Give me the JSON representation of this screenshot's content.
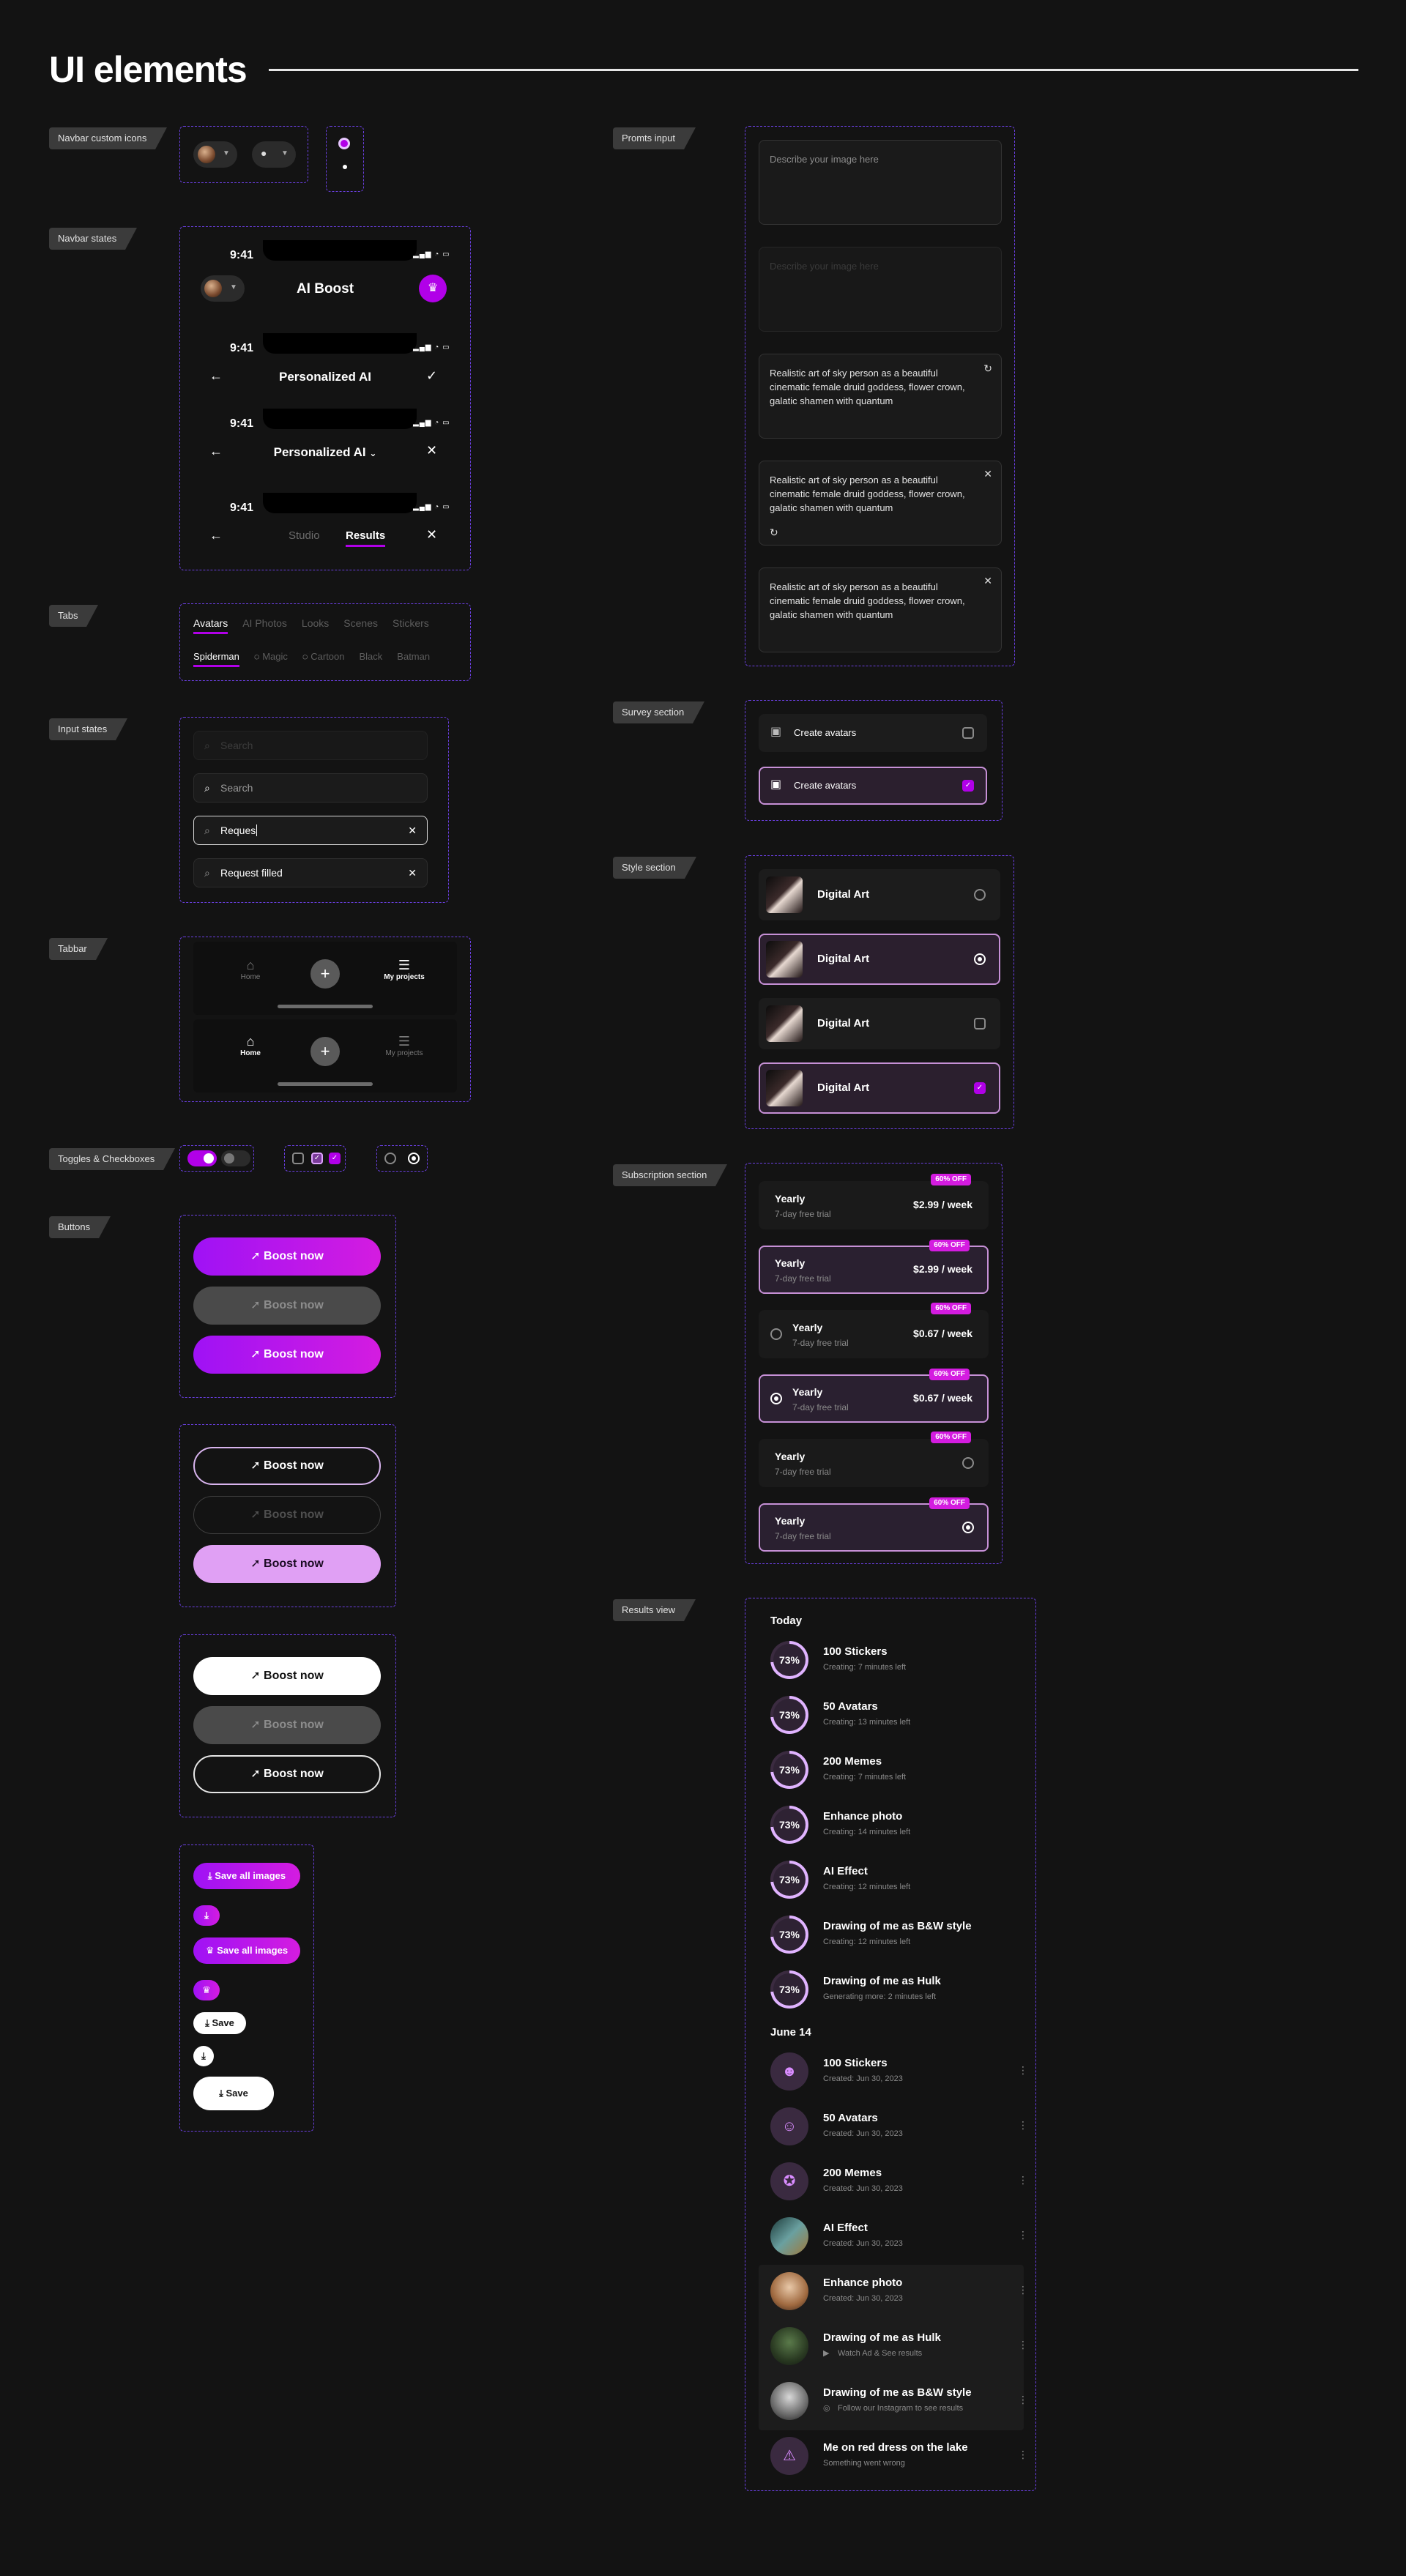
{
  "page": {
    "title": "UI elements"
  },
  "tags": {
    "navbar_icons": "Navbar custom icons",
    "navbar_states": "Navbar states",
    "tabs": "Tabs",
    "input_states": "Input states",
    "tabbar": "Tabbar",
    "toggles": "Toggles & Checkboxes",
    "buttons": "Buttons",
    "prompts": "Promts input",
    "survey": "Survey section",
    "style": "Style section",
    "subscription": "Subscription section",
    "results": "Results view"
  },
  "navbar": {
    "time": "9:41",
    "app_title": "AI Boost",
    "personalized": "Personalized AI",
    "tab_studio": "Studio",
    "tab_results": "Results"
  },
  "tabs": {
    "row1": [
      "Avatars",
      "AI Photos",
      "Looks",
      "Scenes",
      "Stickers"
    ],
    "row2": [
      "Spiderman",
      "Magic",
      "Cartoon",
      "Black",
      "Batman"
    ]
  },
  "inputs": {
    "placeholder": "Search",
    "typing": "Reques",
    "filled": "Request filled"
  },
  "tabbar": {
    "home": "Home",
    "projects": "My projects"
  },
  "buttons": {
    "boost": "Boost now",
    "save_all": "Save all images",
    "save": "Save"
  },
  "prompts": {
    "placeholder": "Describe your image here",
    "text": "Realistic art of sky person as a beautiful cinematic female druid goddess, flower crown, galatic shamen with quantum"
  },
  "survey": {
    "label": "Create avatars"
  },
  "style": {
    "label": "Digital Art"
  },
  "subscription": {
    "badge": "60% OFF",
    "plan": "Yearly",
    "trial": "7-day free trial",
    "price_a": "$2.99 / week",
    "price_b": "$0.67 / week"
  },
  "results": {
    "today": "Today",
    "june": "June 14",
    "progress": "73%",
    "creating": [
      {
        "name": "100 Stickers",
        "sub": "Creating: 7 minutes left"
      },
      {
        "name": "50 Avatars",
        "sub": "Creating: 13 minutes left"
      },
      {
        "name": "200 Memes",
        "sub": "Creating: 7 minutes left"
      },
      {
        "name": "Enhance photo",
        "sub": "Creating: 14 minutes left"
      },
      {
        "name": "AI Effect",
        "sub": "Creating: 12 minutes left"
      },
      {
        "name": "Drawing of me as B&W style",
        "sub": "Creating: 12 minutes left"
      },
      {
        "name": "Drawing of me as Hulk",
        "sub": "Generating more: 2 minutes left"
      }
    ],
    "created": [
      {
        "name": "100 Stickers",
        "sub": "Created: Jun 30, 2023"
      },
      {
        "name": "50 Avatars",
        "sub": "Created: Jun 30, 2023"
      },
      {
        "name": "200 Memes",
        "sub": "Created: Jun 30, 2023"
      },
      {
        "name": "AI Effect",
        "sub": "Created: Jun 30, 2023"
      },
      {
        "name": "Enhance photo",
        "sub": "Created: Jun 30, 2023"
      },
      {
        "name": "Drawing of me as Hulk",
        "sub": "Watch Ad & See results"
      },
      {
        "name": "Drawing of me as B&W style",
        "sub": "Follow our Instagram to see results"
      },
      {
        "name": "Me on red dress on the lake",
        "sub": "Something went wrong"
      }
    ]
  }
}
